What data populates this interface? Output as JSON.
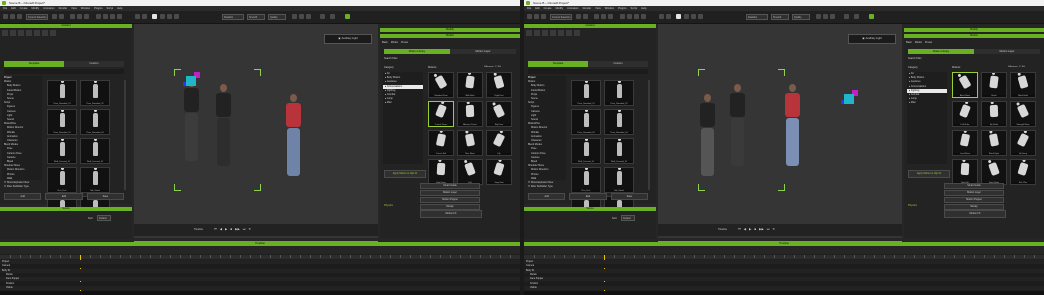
{
  "windows": [
    {
      "id": "left",
      "title": "Scene B – iClone8 Project*",
      "menu": [
        "File",
        "Edit",
        "Create",
        "Modify",
        "Animation",
        "Render",
        "View",
        "Window",
        "Plugins",
        "Script",
        "Help"
      ],
      "toolbar": {
        "mode_combo": "Current Selection",
        "render_combo": "Realistic",
        "fps_combo": "Smooth",
        "quality_combo": "Quality"
      },
      "content_panel": {
        "header": "Content",
        "tabs": [
          "Template",
          "Custom"
        ],
        "tree_header": "Project",
        "tree": [
          "Motion",
          "Body Motion",
          "Facial Motion",
          "Props",
          "Scene",
          "Script",
          "Figures",
          "Camera",
          "Light",
          "Sound",
          "MotionPlus",
          "Motion Director",
          "Wrinkle",
          "Animation",
          "Character",
          "Blend Modes",
          "Pose",
          "Cartoon Pose",
          "Gesture",
          "Biped",
          "Shoulder Move",
          "Motion Direction",
          "Photos",
          "Walk",
          "Run",
          "Jump",
          "Poses"
        ],
        "tree_selected_index": 24,
        "thumbs": [
          "Pose_Standard_01",
          "Pose_Standard_02",
          "Pose_Standard_03",
          "Pose_Standard_04",
          "Walk_Forward_01",
          "Walk_Forward_02",
          "Run_Fast",
          "Idle_Stand",
          "Jump_01",
          "Jump_02"
        ],
        "checks": [
          "Show Exploded View",
          "Filter Subfolder Type"
        ],
        "bottom_labels": [
          "Add",
          "Edit",
          "Save"
        ]
      },
      "scene_panel": {
        "header": "Scene",
        "sort_label": "Sort:",
        "sort_value": "Default"
      },
      "viewport": {
        "camera_label": "Auxiliary Light",
        "camera_icon": "camera-icon"
      },
      "modify_panel": {
        "header": "Modify",
        "subheader": "Motion",
        "tabs": [
          "Basic",
          "Motion",
          "Preset"
        ],
        "sub_tabs": [
          "Motion Library",
          "Motion Layer"
        ],
        "filter_label": "Search Filter",
        "category_header": "Category",
        "category_items": [
          "All",
          "Body Motion",
          "Gestures",
          "Conversations",
          "Fighting",
          "Combat",
          "Jump",
          "Misc"
        ],
        "category_selected_index": 3,
        "motion_header": "Motions",
        "motion_header_right": "Difference: 1 / 100",
        "motions": [
          "Standard Pose",
          "Walk Back",
          "Fight Fast",
          "Crouch Poses",
          "Abstract Poses",
          "Big Pose",
          "Crouch Fall",
          "Rise Move",
          "Fly",
          "Fight Pose",
          "Fall",
          "Jump Fast"
        ],
        "motion_selected_index": 3,
        "apply_button": "Apply Motion to Clip 01",
        "buttons": [
          "Smart Guide",
          "Motion Layer",
          "Motion Puppet",
          "Mocap"
        ],
        "section": "Physics",
        "extra_button": "Motion FX"
      },
      "transport_label": "Timeline",
      "timeline": {
        "header": "Timeline",
        "tracks": [
          "Project",
          "Camera",
          "Body 01",
          "Motion",
          "Face Puppet",
          "Position",
          "Visible"
        ]
      }
    },
    {
      "id": "right",
      "title": "Scene B – iClone8 Project*",
      "menu": [
        "File",
        "Edit",
        "Create",
        "Modify",
        "Animation",
        "Render",
        "View",
        "Window",
        "Plugins",
        "Script",
        "Help"
      ],
      "toolbar": {
        "mode_combo": "Current Selection",
        "render_combo": "Realistic",
        "fps_combo": "Smooth",
        "quality_combo": "Quality"
      },
      "content_panel": {
        "header": "Content",
        "tabs": [
          "Template",
          "Custom"
        ],
        "tree_header": "Project",
        "tree": [
          "Motion",
          "Body Motion",
          "Facial Motion",
          "Props",
          "Scene",
          "Script",
          "Figures",
          "Camera",
          "Light",
          "Sound",
          "MotionPlus",
          "Motion Director",
          "Wrinkle",
          "Animation",
          "Character",
          "Blend Modes",
          "Pose",
          "Cartoon Pose",
          "Gesture",
          "Biped",
          "Shoulder Move",
          "Motion Direction",
          "Photos",
          "Walk",
          "Run",
          "Jump",
          "Poses"
        ],
        "tree_selected_index": 24,
        "thumbs": [
          "Pose_Standard_01",
          "Pose_Standard_02",
          "Pose_Standard_03",
          "Pose_Standard_04",
          "Walk_Forward_01",
          "Walk_Forward_02",
          "Run_Fast",
          "Idle_Stand",
          "Jump_01",
          "Jump_02"
        ],
        "checks": [
          "Show Exploded View",
          "Filter Subfolder Type"
        ],
        "bottom_labels": [
          "Add",
          "Edit",
          "Save"
        ]
      },
      "scene_panel": {
        "header": "Scene",
        "sort_label": "Sort:",
        "sort_value": "Default"
      },
      "viewport": {
        "camera_label": "Auxiliary Light",
        "camera_icon": "camera-icon"
      },
      "modify_panel": {
        "header": "Modify",
        "subheader": "Motion",
        "tabs": [
          "Basic",
          "Motion",
          "Preset"
        ],
        "sub_tabs": [
          "Motion Library",
          "Motion Layer"
        ],
        "filter_label": "Search Filter",
        "category_header": "Category",
        "category_items": [
          "All",
          "Body Motion",
          "Gestures",
          "Conversations",
          "Fighting",
          "Combat",
          "Jump",
          "Misc"
        ],
        "category_selected_index": 4,
        "motion_header": "Motions",
        "motion_header_right": "Difference: 1 / 100",
        "motions": [
          "Block Move",
          "Break",
          "Block Hold",
          "Fall Strike",
          "Fly Strike",
          "Strength Move",
          "Land Move",
          "Block Fight",
          "Hit Jump",
          "Back Hit",
          "Fight Strike",
          "Kick Plus"
        ],
        "motion_selected_index": 0,
        "apply_button": "Apply Motion to Clip 01",
        "buttons": [
          "Smart Guide",
          "Motion Layer",
          "Motion Puppet",
          "Mocap"
        ],
        "section": "Physics",
        "extra_button": "Motion FX"
      },
      "transport_label": "Timeline",
      "timeline": {
        "header": "Timeline",
        "tracks": [
          "Project",
          "Camera",
          "Body 01",
          "Motion",
          "Face Puppet",
          "Position",
          "Visible"
        ]
      }
    }
  ],
  "colors": {
    "accent": "#6ab023",
    "panel": "#232323",
    "viewport": "#353535",
    "titlebar": "#f2f2f2"
  }
}
